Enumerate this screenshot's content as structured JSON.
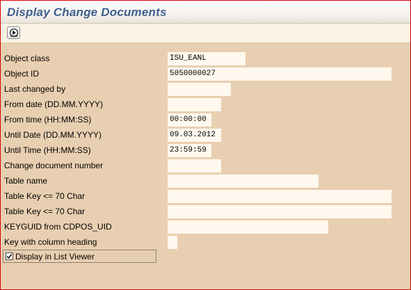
{
  "window": {
    "title": "Display Change Documents"
  },
  "toolbar": {
    "execute_icon": "execute-icon"
  },
  "fields": [
    {
      "label": "Object class",
      "value": "ISU_EANL"
    },
    {
      "label": "Object ID",
      "value": "5050000027"
    },
    {
      "label": "Last changed by",
      "value": ""
    },
    {
      "label": "From date (DD.MM.YYYY)",
      "value": ""
    },
    {
      "label": "From time (HH:MM:SS)",
      "value": "00:00:00"
    },
    {
      "label": "Until Date (DD.MM.YYYY)",
      "value": "09.03.2012"
    },
    {
      "label": "Until Time (HH:MM:SS)",
      "value": "23:59:59"
    },
    {
      "label": "Change document number",
      "value": ""
    },
    {
      "label": "Table name",
      "value": ""
    },
    {
      "label": "Table Key <= 70 Char",
      "value": ""
    },
    {
      "label": "Table Key <= 70 Char",
      "value": ""
    },
    {
      "label": "KEYGUID from CDPOS_UID",
      "value": ""
    },
    {
      "label": "Key with column heading",
      "value": ""
    }
  ],
  "options": {
    "list_viewer_label": "Display in List Viewer",
    "list_viewer_checked": true
  },
  "colors": {
    "title": "#3f5f8d",
    "background": "#e9cfb1",
    "field": "#fff8ee",
    "frame": "#d40000"
  }
}
